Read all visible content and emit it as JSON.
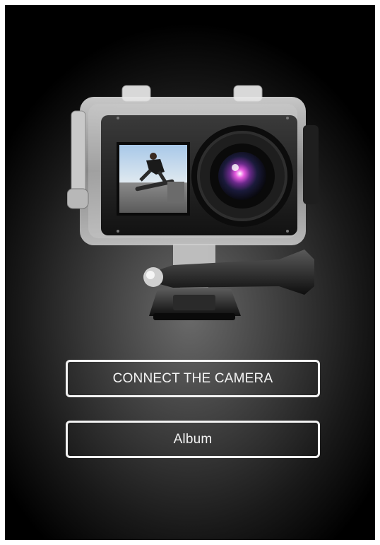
{
  "screen": {
    "background_center": "#6a6a6a",
    "background_edge": "#000000"
  },
  "hero": {
    "icon": "action-camera-icon"
  },
  "buttons": {
    "connect_label": "CONNECT THE CAMERA",
    "album_label": "Album",
    "border_color": "#f2f2f2",
    "text_color": "#f4f4f4"
  }
}
